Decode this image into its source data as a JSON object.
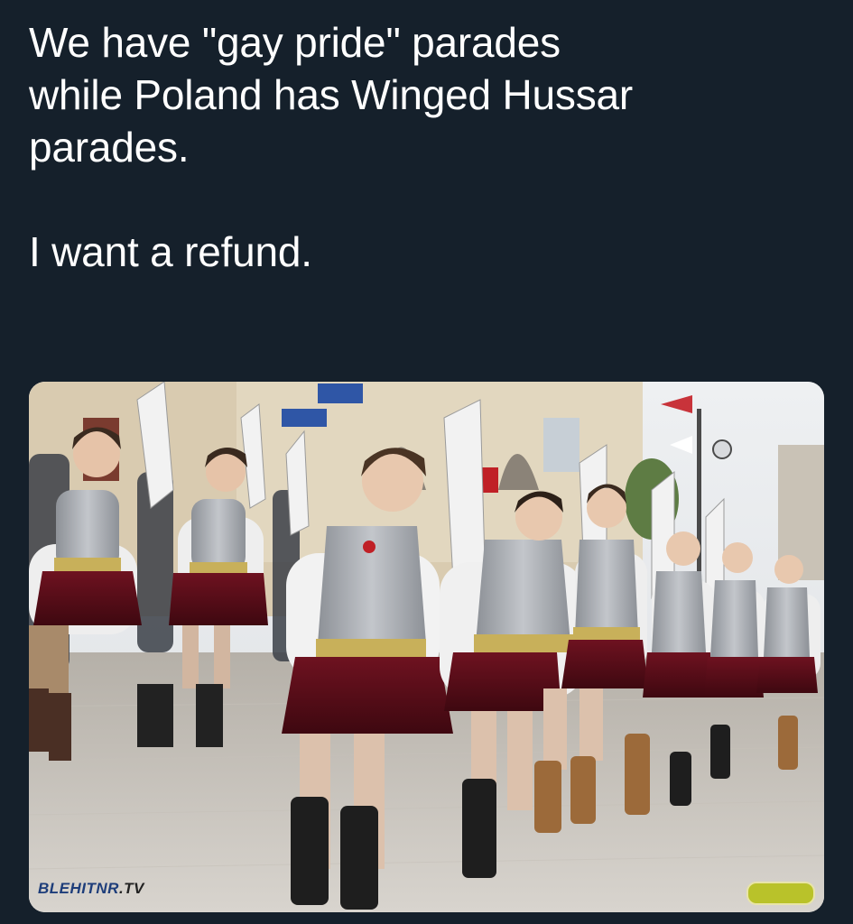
{
  "tweet": {
    "line1": "We have \"gay pride\" parades",
    "line2": "while Poland has Winged Hussar",
    "line3": "parades.",
    "line4": "I want a refund."
  },
  "media": {
    "watermark_brand": "BLEHITNR",
    "watermark_suffix": ".TV"
  },
  "colors": {
    "background": "#15202b",
    "text": "#ffffff",
    "armor": "#a9adb3",
    "skirt": "#5c0d17",
    "gold_trim": "#c8b05a"
  }
}
